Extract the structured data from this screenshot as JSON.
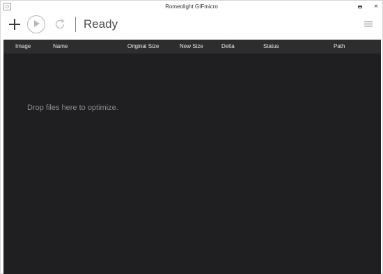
{
  "window": {
    "title": "Romeolight GIFmicro"
  },
  "toolbar": {
    "status_text": "Ready"
  },
  "table": {
    "columns": [
      "Image",
      "Name",
      "Original Size",
      "New Size",
      "Delta",
      "Status",
      "Path"
    ]
  },
  "content": {
    "drop_hint": "Drop files here to optimize."
  },
  "icons": {
    "app": "app-icon",
    "add": "plus-icon",
    "play": "play-icon",
    "refresh": "refresh-icon",
    "menu": "hamburger-menu-icon",
    "minimize": "minimize-icon",
    "close": "close-icon"
  },
  "colors": {
    "table_header_bg": "#2d2d30",
    "content_bg": "#1f1f22",
    "hint_text": "#8c8c8c",
    "status_text": "#4a4a4a"
  }
}
